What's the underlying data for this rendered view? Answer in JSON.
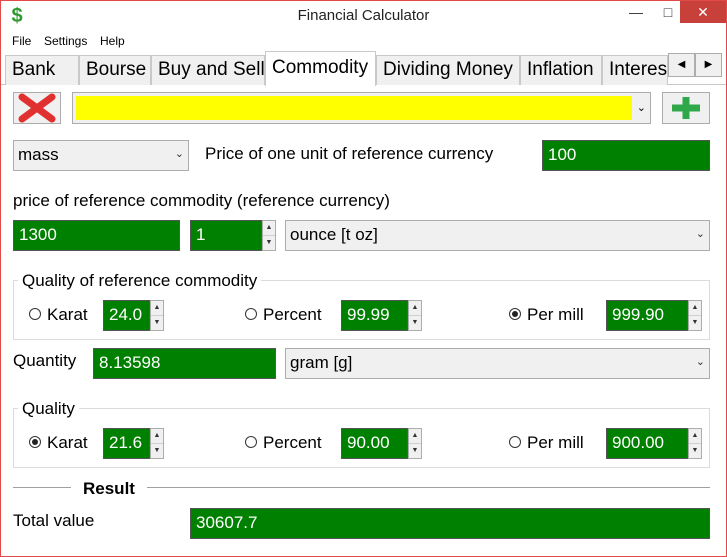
{
  "window": {
    "title": "Financial Calculator"
  },
  "menu": [
    "File",
    "Settings",
    "Help"
  ],
  "tabs": [
    {
      "label": "Bank"
    },
    {
      "label": "Bourse"
    },
    {
      "label": "Buy and Sell"
    },
    {
      "label": "Commodity"
    },
    {
      "label": "Dividing Money"
    },
    {
      "label": "Inflation"
    },
    {
      "label": "Interest"
    }
  ],
  "active_tab": "Commodity",
  "toolbar": {
    "combo_value": ""
  },
  "top": {
    "measure_select": "mass",
    "ref_price_label": "Price of one unit of reference currency",
    "ref_price_value": "100"
  },
  "ref_commodity": {
    "label": "price of reference commodity (reference currency)",
    "price": "1300",
    "quantity": "1",
    "unit": "ounce [t oz]"
  },
  "ref_quality": {
    "label": "Quality of reference commodity",
    "karat_label": "Karat",
    "karat_value": "24.0",
    "percent_label": "Percent",
    "percent_value": "99.99",
    "permill_label": "Per mill",
    "permill_value": "999.90",
    "selected": "permill"
  },
  "quantity": {
    "label": "Quantity",
    "value": "8.13598",
    "unit": "gram [g]"
  },
  "quality": {
    "label": "Quality",
    "karat_label": "Karat",
    "karat_value": "21.6",
    "percent_label": "Percent",
    "percent_value": "90.00",
    "permill_label": "Per mill",
    "permill_value": "900.00",
    "selected": "karat"
  },
  "result": {
    "heading": "Result",
    "total_label": "Total value",
    "total_value": "30607.7"
  },
  "colors": {
    "field_green": "#008000",
    "combo_yellow": "#ffff00",
    "delete_red": "#e03030",
    "add_green": "#2fa84a"
  }
}
